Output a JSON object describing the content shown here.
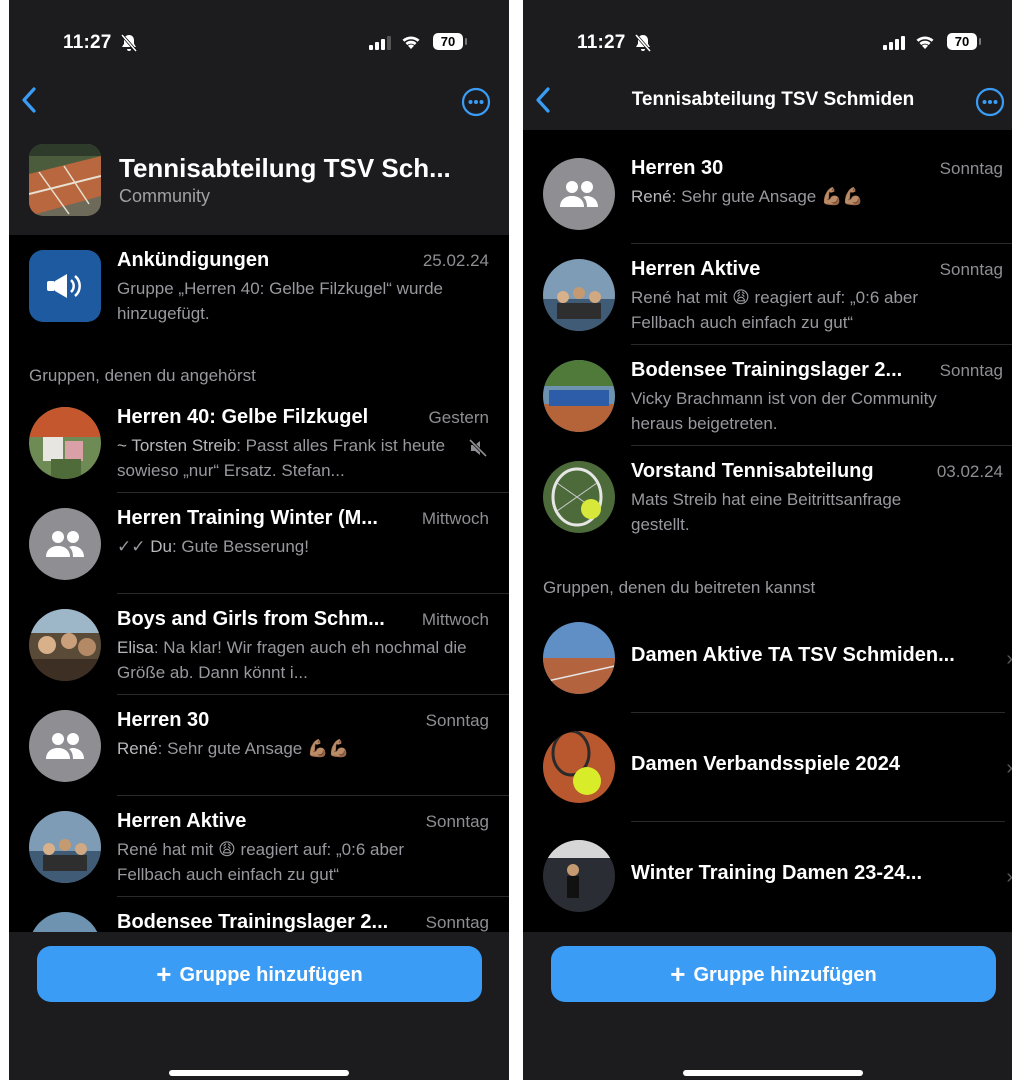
{
  "left": {
    "status": {
      "time": "11:27",
      "battery": "70"
    },
    "community": {
      "title": "Tennisabteilung TSV Sch...",
      "subtitle": "Community"
    },
    "announcement": {
      "title": "Ankündigungen",
      "date": "25.02.24",
      "preview": "Gruppe „Herren 40: Gelbe Filzkugel“ wurde hinzugefügt."
    },
    "section_member": "Gruppen, denen du angehörst",
    "groups": [
      {
        "title": "Herren 40: Gelbe Filzkugel",
        "date": "Gestern",
        "sender": "~ Torsten Streib",
        "text": ": Passt alles Frank ist heute sowieso „nur“ Ersatz. Stefan..."
      },
      {
        "title": "Herren Training Winter (M...",
        "date": "Mittwoch",
        "sender": "Du",
        "text": ": Gute Besserung!"
      },
      {
        "title": "Boys and Girls from Schm...",
        "date": "Mittwoch",
        "sender": "Elisa",
        "text": ": Na klar! Wir fragen auch eh nochmal die Größe ab. Dann könnt i..."
      },
      {
        "title": "Herren 30",
        "date": "Sonntag",
        "sender": "René",
        "text": ": Sehr gute Ansage 💪🏽💪🏽"
      },
      {
        "title": "Herren Aktive",
        "date": "Sonntag",
        "text": "René hat mit 😩 reagiert auf: „0:6 aber Fellbach auch einfach zu gut“"
      },
      {
        "title": "Bodensee Trainingslager 2...",
        "date": "Sonntag"
      }
    ],
    "add_button": "Gruppe hinzufügen"
  },
  "right": {
    "status": {
      "time": "11:27",
      "battery": "70"
    },
    "nav_title": "Tennisabteilung TSV Schmiden",
    "groups": [
      {
        "title": "Herren 30",
        "date": "Sonntag",
        "sender": "René",
        "text": ": Sehr gute Ansage 💪🏽💪🏽"
      },
      {
        "title": "Herren Aktive",
        "date": "Sonntag",
        "text": "René hat mit 😩 reagiert auf: „0:6 aber Fellbach auch einfach zu gut“"
      },
      {
        "title": "Bodensee Trainingslager 2...",
        "date": "Sonntag",
        "text": "Vicky Brachmann ist von der Community heraus beigetreten."
      },
      {
        "title": "Vorstand Tennisabteilung",
        "date": "03.02.24",
        "text": "Mats Streib hat eine Beitrittsanfrage gestellt."
      }
    ],
    "section_join": "Gruppen, denen du beitreten kannst",
    "join_groups": [
      {
        "title": "Damen Aktive TA TSV Schmiden..."
      },
      {
        "title": "Damen Verbandsspiele 2024"
      },
      {
        "title": "Winter Training Damen 23-24..."
      }
    ],
    "add_button": "Gruppe hinzufügen"
  },
  "colors": {
    "accent": "#3a9cf5",
    "background": "#000000",
    "header": "#1c1c1e",
    "secondary_text": "#98989e"
  },
  "icons": [
    "bell-slash-icon",
    "signal-icon",
    "wifi-icon",
    "battery-icon",
    "back-chevron-icon",
    "more-ellipsis-icon",
    "megaphone-icon",
    "group-people-icon",
    "muted-icon",
    "double-check-icon",
    "chevron-right-icon",
    "plus-icon"
  ]
}
